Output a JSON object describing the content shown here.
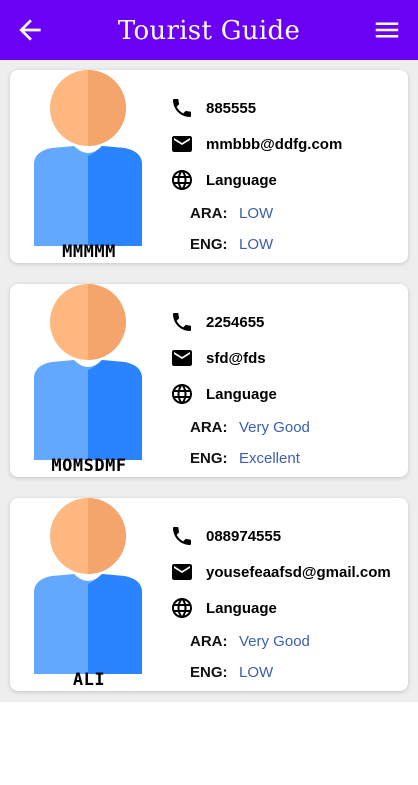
{
  "header": {
    "title": "Tourist Guide",
    "back_icon": "arrow-left-icon",
    "menu_icon": "hamburger-menu-icon",
    "background": "#6a00f4"
  },
  "guides": [
    {
      "name": "MMMMM",
      "phone": "885555",
      "email": "mmbbb@ddfg.com",
      "language_label": "Language",
      "languages": [
        {
          "code": "ARA:",
          "level": "LOW"
        },
        {
          "code": "ENG:",
          "level": "LOW"
        }
      ]
    },
    {
      "name": "MOMSDMF",
      "phone": "2254655",
      "email": "sfd@fds",
      "language_label": "Language",
      "languages": [
        {
          "code": "ARA:",
          "level": "Very Good"
        },
        {
          "code": "ENG:",
          "level": "Excellent"
        }
      ]
    },
    {
      "name": "ALI",
      "phone": "088974555",
      "email": "yousefeaafsd@gmail.com",
      "language_label": "Language",
      "languages": [
        {
          "code": "ARA:",
          "level": "Very Good"
        },
        {
          "code": "ENG:",
          "level": "LOW"
        }
      ]
    }
  ],
  "icons": {
    "phone": "phone-icon",
    "email": "mail-icon",
    "language": "globe-icon",
    "avatar": "user-avatar-icon"
  },
  "colors": {
    "skin_light": "#fdb77f",
    "skin_dark": "#f4a56c",
    "shirt_light": "#62a8ff",
    "shirt_dark": "#2a84ff",
    "level_text": "#3b5fa8"
  }
}
